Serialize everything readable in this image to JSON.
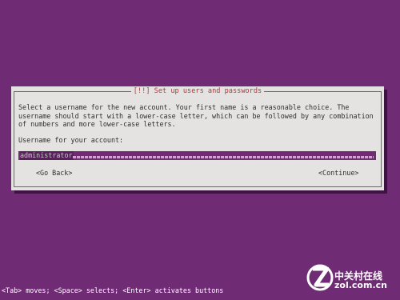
{
  "dialog": {
    "title": "[!!] Set up users and passwords",
    "description_lines": [
      "Select a username for the new account. Your first name is a reasonable choice. The",
      "username should start with a lower-case letter, which can be followed by any combination",
      "of numbers and more lower-case letters."
    ],
    "field_label": "Username for your account:",
    "username_value": "administrator",
    "go_back_label": "<Go Back>",
    "continue_label": "<Continue>"
  },
  "status_bar": {
    "text": "<Tab> moves; <Space> selects; <Enter> activates buttons"
  },
  "watermark": {
    "chinese": "中关村在线",
    "domain": "zol.com.cn"
  },
  "colors": {
    "background": "#6f2b74",
    "dialog": "#e5e3e2",
    "title": "#b3363a",
    "input": "#712a73"
  }
}
